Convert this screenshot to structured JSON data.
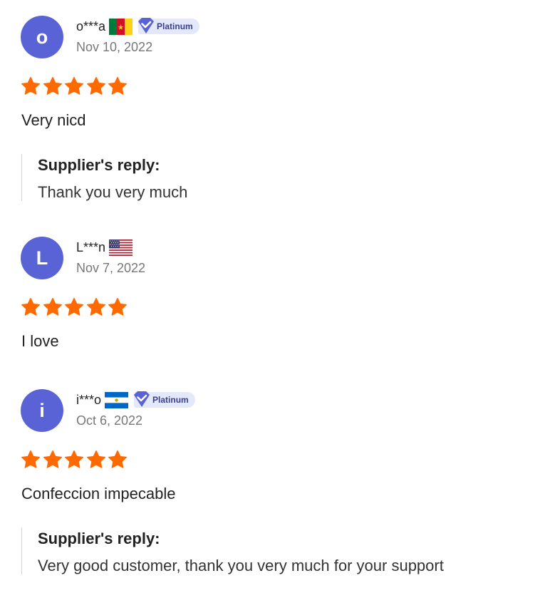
{
  "reviews": [
    {
      "avatar_letter": "o",
      "username": "o***a",
      "flag": "cameroon-flag",
      "badge": "Platinum",
      "date": "Nov 10, 2022",
      "rating": 5,
      "comment": "Very nicd",
      "reply": {
        "title": "Supplier's reply:",
        "text": "Thank you very much"
      }
    },
    {
      "avatar_letter": "L",
      "username": "L***n",
      "flag": "usa-flag",
      "date": "Nov 7, 2022",
      "rating": 5,
      "comment": "I love"
    },
    {
      "avatar_letter": "i",
      "username": "i***o",
      "flag": "nicaragua-flag",
      "badge": "Platinum",
      "date": "Oct 6, 2022",
      "rating": 5,
      "comment": "Confeccion impecable",
      "reply": {
        "title": "Supplier's reply:",
        "text": "Very good customer, thank you very much for your support"
      }
    }
  ],
  "colors": {
    "avatar_bg": "#5a63d6",
    "star": "#ff6a00",
    "badge_bg": "#e4e8fb",
    "badge_icon": "#5a63d6",
    "date_text": "#777777"
  }
}
